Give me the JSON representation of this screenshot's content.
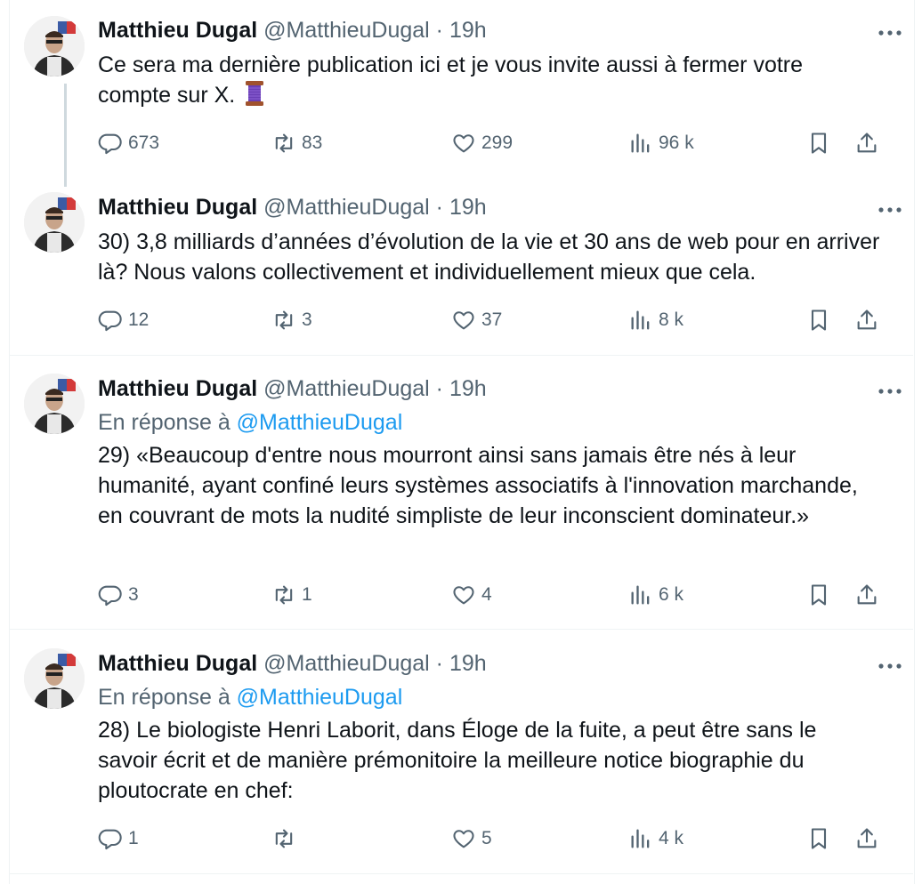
{
  "author": {
    "name": "Matthieu Dugal",
    "handle": "@MatthieuDugal",
    "separator": "·"
  },
  "colors": {
    "text": "#0f1419",
    "secondary": "#536471",
    "link": "#1d9bf0",
    "divider": "#eff3f4",
    "thread_line": "#cfd9de"
  },
  "tweets": [
    {
      "time": "19h",
      "reply_prefix": "",
      "reply_mention": "",
      "text": "Ce sera ma dernière publication ici et je vous invite aussi à fermer votre compte sur X.",
      "emoji": "spool-of-thread-icon",
      "replies": "673",
      "reposts": "83",
      "likes": "299",
      "views": "96 k"
    },
    {
      "time": "19h",
      "reply_prefix": "",
      "reply_mention": "",
      "text": "30) 3,8 milliards d’années d’évolution de la vie et 30 ans de web pour en arriver là? Nous valons collectivement et individuellement mieux que cela.",
      "replies": "12",
      "reposts": "3",
      "likes": "37",
      "views": "8 k"
    },
    {
      "time": "19h",
      "reply_prefix": "En réponse à",
      "reply_mention": "@MatthieuDugal",
      "text": "29) «Beaucoup d'entre nous mourront ainsi sans jamais être nés à leur humanité, ayant confiné leurs systèmes associatifs à l'innovation marchande, en couvrant de mots la nudité simpliste de leur inconscient dominateur.»",
      "replies": "3",
      "reposts": "1",
      "likes": "4",
      "views": "6 k"
    },
    {
      "time": "19h",
      "reply_prefix": "En réponse à",
      "reply_mention": "@MatthieuDugal",
      "text": "28) Le biologiste Henri Laborit, dans Éloge de la fuite, a peut être sans le savoir écrit et de manière prémonitoire la meilleure notice biographie du ploutocrate en chef:",
      "replies": "1",
      "reposts": "",
      "likes": "5",
      "views": "4 k"
    }
  ]
}
